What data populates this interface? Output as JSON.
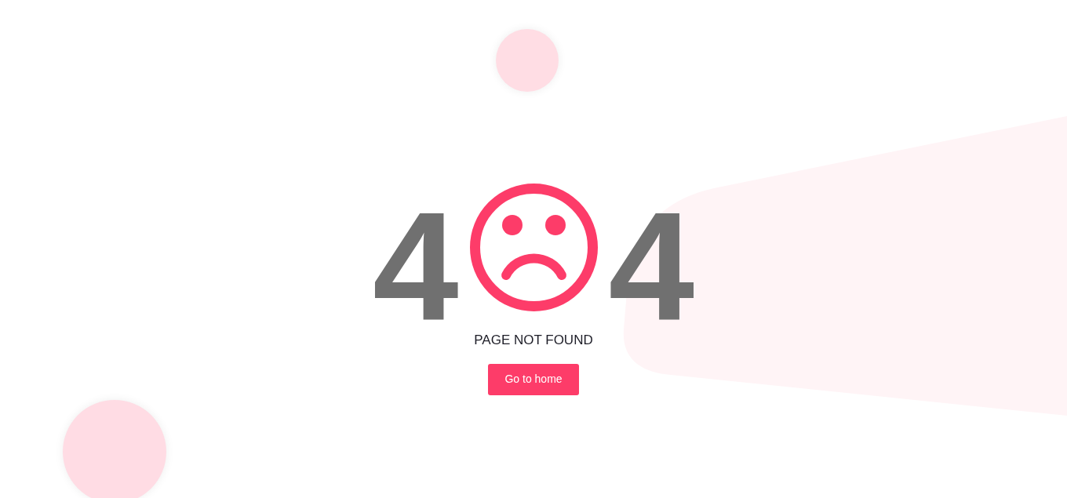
{
  "error_code": {
    "first_digit": "4",
    "last_digit": "4"
  },
  "message": "PAGE NOT FOUND",
  "home_button": {
    "label": "Go to home"
  }
}
